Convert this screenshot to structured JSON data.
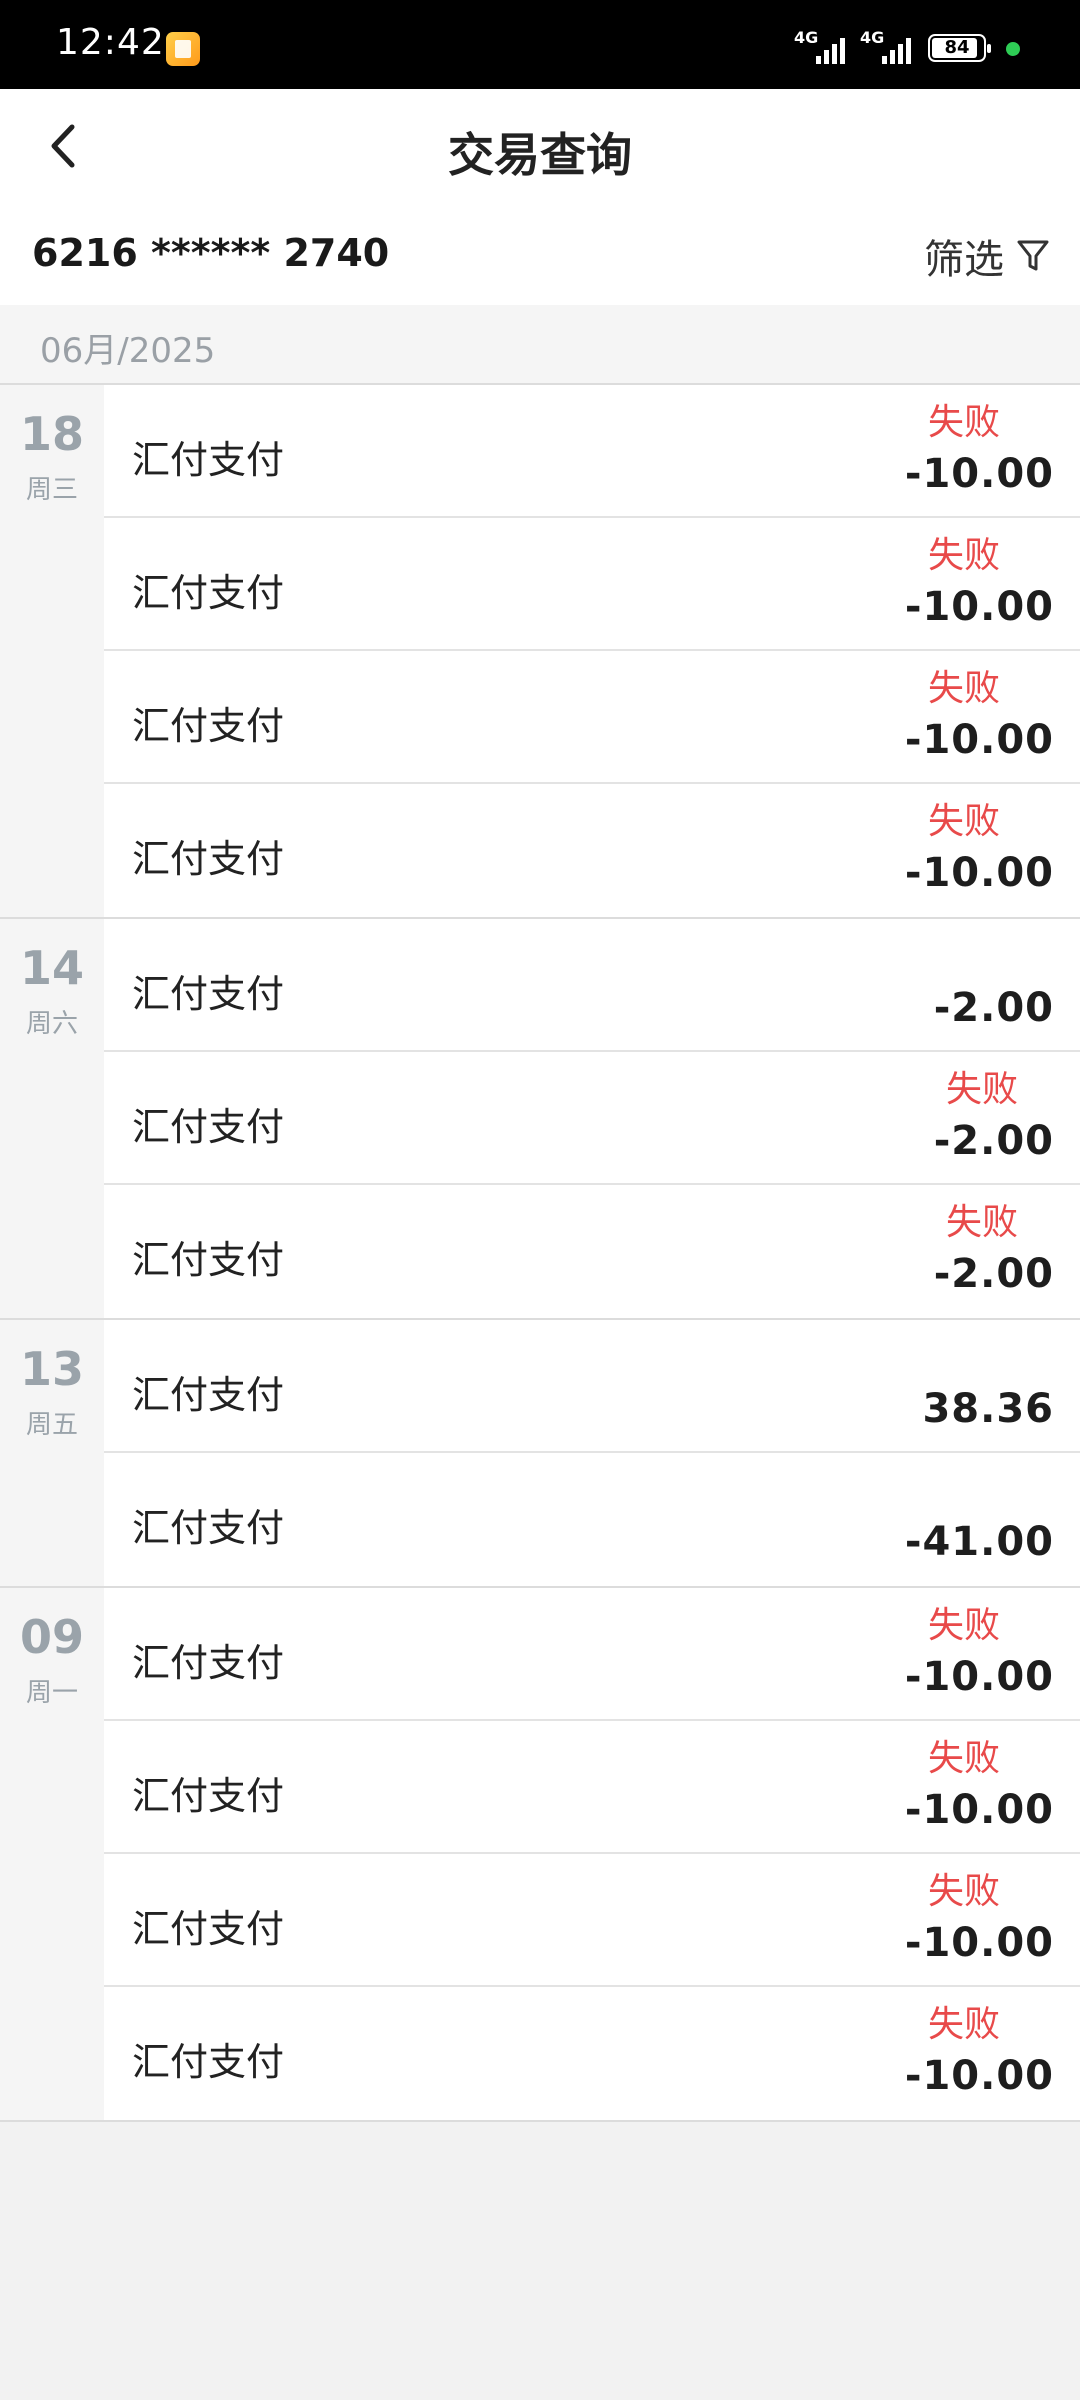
{
  "status_bar": {
    "time": "12:42",
    "signal1": "4G",
    "signal2": "4G",
    "battery": "84",
    "battery_level": 0.84
  },
  "nav": {
    "title": "交易查询"
  },
  "account": {
    "number": "6216 ****** 2740",
    "filter_label": "筛选"
  },
  "month": {
    "label": "06月/2025"
  },
  "groups": [
    {
      "day": "18",
      "weekday": "周三",
      "rows": [
        {
          "title": "汇付支付",
          "status": "失败",
          "amount": "-10.00"
        },
        {
          "title": "汇付支付",
          "status": "失败",
          "amount": "-10.00"
        },
        {
          "title": "汇付支付",
          "status": "失败",
          "amount": "-10.00"
        },
        {
          "title": "汇付支付",
          "status": "失败",
          "amount": "-10.00"
        }
      ]
    },
    {
      "day": "14",
      "weekday": "周六",
      "rows": [
        {
          "title": "汇付支付",
          "status": "",
          "amount": "-2.00"
        },
        {
          "title": "汇付支付",
          "status": "失败",
          "amount": "-2.00"
        },
        {
          "title": "汇付支付",
          "status": "失败",
          "amount": "-2.00"
        }
      ]
    },
    {
      "day": "13",
      "weekday": "周五",
      "rows": [
        {
          "title": "汇付支付",
          "status": "",
          "amount": "38.36"
        },
        {
          "title": "汇付支付",
          "status": "",
          "amount": "-41.00"
        }
      ]
    },
    {
      "day": "09",
      "weekday": "周一",
      "rows": [
        {
          "title": "汇付支付",
          "status": "失败",
          "amount": "-10.00"
        },
        {
          "title": "汇付支付",
          "status": "失败",
          "amount": "-10.00"
        },
        {
          "title": "汇付支付",
          "status": "失败",
          "amount": "-10.00"
        },
        {
          "title": "汇付支付",
          "status": "失败",
          "amount": "-10.00"
        }
      ]
    }
  ]
}
